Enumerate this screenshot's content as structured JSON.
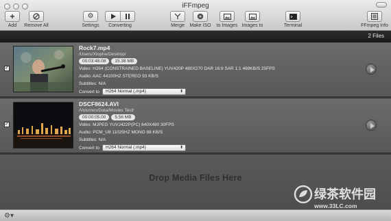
{
  "window": {
    "title": "iFFmpeg"
  },
  "toolbar": {
    "add": "Add",
    "remove_all": "Remove All",
    "settings": "Settings",
    "converting": "Converting",
    "merge": "Merge",
    "make_iso": "Make ISO",
    "to_images": "to Images",
    "images_to": "Images to",
    "terminal": "Terminal",
    "ffmpeg_info": "FFmpeg Info"
  },
  "header": {
    "file_count": "2 Files"
  },
  "files": [
    {
      "name": "Rock7.mp4",
      "path": "/Users/Xtophe/Desktop/",
      "duration": "00:03:48.08",
      "size": "15.38 MB",
      "video": "Video: H264 (CONSTRAINED BASELINE)  YUV420P  480X270   DAR 16:9  SAR 1:1  469KB/S   25FPS",
      "audio": "Audio: AAC  44100HZ  STEREO    93 KB/S",
      "subtitles": "Subtitles: N/A",
      "convert_label": "Convert to",
      "convert_value": "H264 Normal (.mp4)",
      "checked": true
    },
    {
      "name": "DSCF8624.AVI",
      "path": "/Volumes/Data/Movies Test/",
      "duration": "00:00:05.00",
      "size": "5.56 MB",
      "video": "Video: MJPEG  YUVJ422P(PC)  640X480   30FPS",
      "audio": "Audio: PCM_U8  11025HZ  MONO    88 KB/S",
      "subtitles": "Subtitles: N/A",
      "convert_label": "Convert to",
      "convert_value": "H264 Normal (.mp4)",
      "checked": true
    }
  ],
  "drop_zone": {
    "text": "Drop Media Files Here"
  },
  "watermark": {
    "text": "绿茶软件园",
    "url": "www.33LC.com"
  },
  "icons": {
    "add": "plus-icon",
    "remove_all": "remove-icon",
    "settings": "gear-icon",
    "converting": "play-pause-icon",
    "merge": "merge-icon",
    "make_iso": "disc-icon",
    "to_images": "image-icon",
    "images_to": "image-icon",
    "terminal": "terminal-icon",
    "ffmpeg_info": "list-icon"
  }
}
